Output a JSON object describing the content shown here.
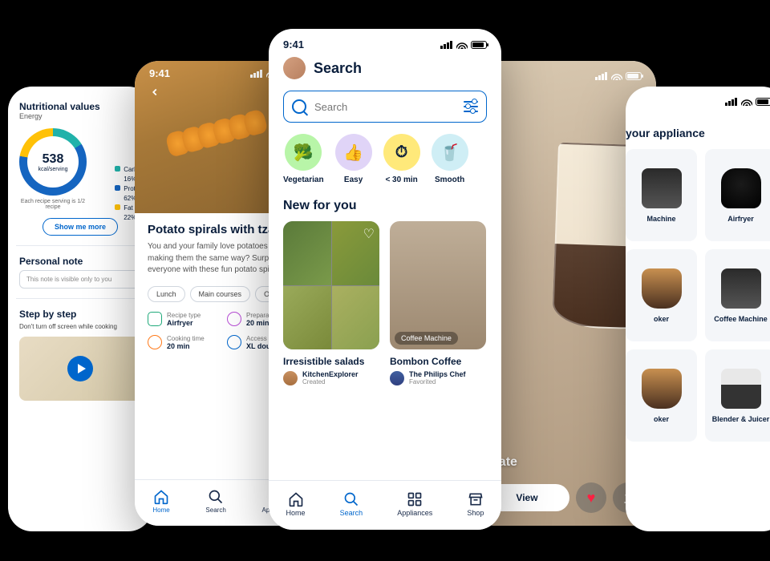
{
  "status": {
    "time": "9:41"
  },
  "p1": {
    "title": "Nutritional values",
    "subtitle": "Energy",
    "kcal": "538",
    "kcal_unit": "kcal/serving",
    "legend": [
      {
        "label": "Carbo",
        "pct": "16%",
        "color": "#20b2aa"
      },
      {
        "label": "Protei",
        "pct": "62%",
        "color": "#1565c0"
      },
      {
        "label": "Fat",
        "pct": "22%",
        "color": "#ffc107"
      }
    ],
    "serving_note": "Each recipe serving is 1/2 recipe",
    "show_more": "Show me more",
    "note_title": "Personal note",
    "note_placeholder": "This note is visible only to you",
    "step_title": "Step by step",
    "step_hint": "Don't turn off screen while cooking"
  },
  "p2": {
    "title": "Potato spirals with tzatz",
    "desc": "You and your family love potatoes bu of making them the same way? Surp everyone with these fun potato spiral",
    "tags": [
      "Lunch",
      "Main courses",
      "One p"
    ],
    "meta": [
      {
        "label": "Recipe type",
        "value": "Airfryer",
        "color": "#1fa97a"
      },
      {
        "label": "Prepara",
        "value": "20 min",
        "color": "#b84dd6"
      },
      {
        "label": "Cooking time",
        "value": "20 min",
        "color": "#ff7a1a"
      },
      {
        "label": "Access",
        "value": "XL dou",
        "color": "#0066cc"
      }
    ],
    "tabs": [
      "Home",
      "Search",
      "Appliances"
    ]
  },
  "p3": {
    "title": "Search",
    "search_placeholder": "Search",
    "filters": [
      {
        "label": "Vegetarian",
        "color": "#b8f5a8",
        "icon": "🥦"
      },
      {
        "label": "Easy",
        "color": "#e0d4f7",
        "icon": "👍"
      },
      {
        "label": "< 30 min",
        "color": "#ffe97a",
        "icon": "⏱"
      },
      {
        "label": "Smooth",
        "color": "#cfeef5",
        "icon": "🥤"
      }
    ],
    "new_title": "New for you",
    "cards": [
      {
        "title": "Irresistible salads",
        "author": "KitchenExplorer",
        "status": "Created",
        "badge": ""
      },
      {
        "title": "Bombon Coffee",
        "author": "The Philips Chef",
        "status": "Favorited",
        "badge": "Coffee Machine"
      }
    ],
    "tabs": [
      "Home",
      "Search",
      "Appliances",
      "Shop"
    ]
  },
  "p4": {
    "title": "y late",
    "view": "View"
  },
  "p5": {
    "title": "your appliance",
    "items": [
      {
        "label": "Machine",
        "kind": "cm"
      },
      {
        "label": "Airfryer",
        "kind": "air"
      },
      {
        "label": "oker",
        "kind": "cook"
      },
      {
        "label": "Coffee Machine",
        "kind": "cm"
      },
      {
        "label": "oker",
        "kind": "cook"
      },
      {
        "label": "Blender & Juicer",
        "kind": "blend"
      }
    ]
  }
}
